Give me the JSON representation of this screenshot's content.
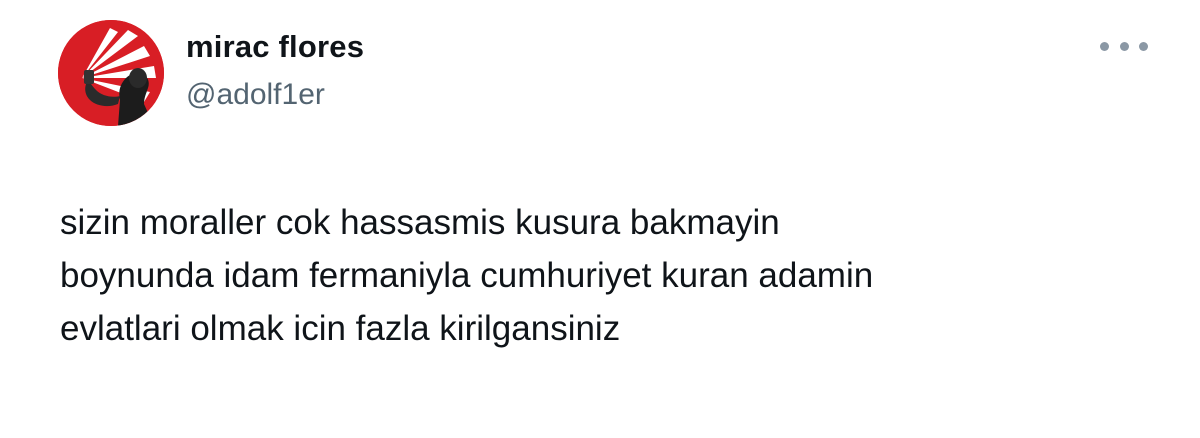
{
  "author": {
    "display_name": "mirac flores",
    "handle": "@adolf1er",
    "avatar_icon": "profile-photo-red-rays"
  },
  "tweet": {
    "lines": [
      "sizin moraller cok hassasmis kusura bakmayin",
      "boynunda idam fermaniyla cumhuriyet kuran adamin",
      "evlatlari olmak icin fazla kirilgansiniz"
    ]
  },
  "actions": {
    "more_icon": "more-horizontal-icon"
  },
  "colors": {
    "text": "#0f1419",
    "secondary": "#536471",
    "avatar_red": "#d81e25"
  }
}
